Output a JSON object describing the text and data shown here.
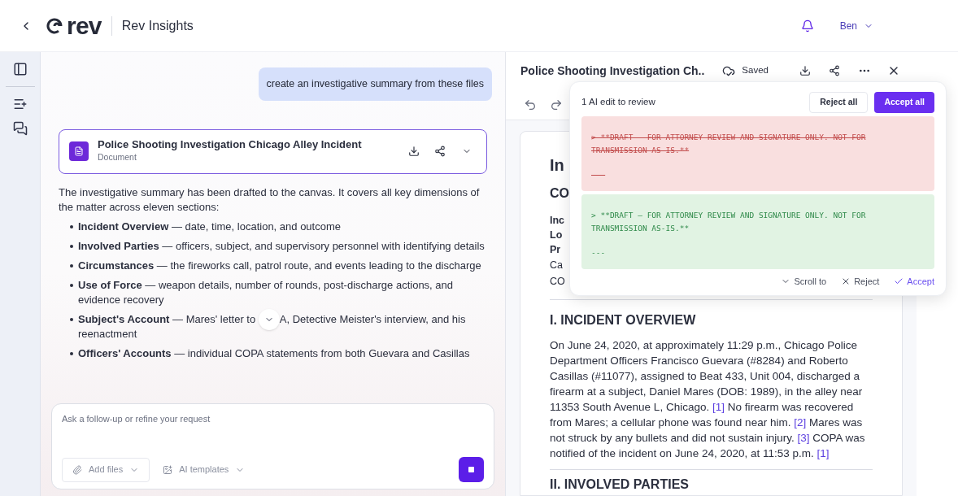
{
  "header": {
    "logo_text": "rev",
    "app_title": "Rev Insights",
    "user": "Ben"
  },
  "chat": {
    "user_message": "create an investigative summary from these files",
    "document_card": {
      "title": "Police Shooting Investigation Chicago Alley Incident",
      "subtitle": "Document"
    },
    "intro": "The investigative summary has been drafted to the canvas. It covers all key dimensions of the matter across eleven sections:",
    "bullets": [
      {
        "text": "**Incident Overview** — date, time, location, and outcome"
      },
      {
        "text": "**Involved Parties** — officers, subject, and supervisory personnel with identifying details"
      },
      {
        "text": "**Circumstances** — the fireworks call, patrol route, and events leading to the discharge"
      },
      {
        "text": "**Use of Force** — weapon details, number of rounds, post-discharge actions, and evidence recovery"
      },
      {
        "text": "**Subject's Account** — Mares' letter to",
        "after_button": "A, Detective Meister's interview, and his reenactment"
      },
      {
        "text": "**Officers' Accounts** — individual COPA statements from both Guevara and Casillas"
      }
    ],
    "input": {
      "placeholder": "Ask a follow-up or refine your request",
      "add_files": "Add files",
      "templates": "AI templates"
    }
  },
  "document": {
    "title": "Police Shooting Investigation Ch..",
    "save_status": "Saved",
    "hidden_fragments": [
      {
        "kind": "h1",
        "text": "In"
      },
      {
        "kind": "h2",
        "text": "CO"
      },
      {
        "kind": "bold",
        "text": "Inc"
      },
      {
        "kind": "bold",
        "text": "Lo"
      },
      {
        "kind": "bold",
        "text": "Pr"
      },
      {
        "kind": "plain",
        "text": "Ca"
      },
      {
        "kind": "plain",
        "text": "CO"
      }
    ],
    "section_1": {
      "heading": "I. INCIDENT OVERVIEW",
      "segments": [
        {
          "kind": "text",
          "text": "On June 24, 2020, at approximately 11:29 p.m., Chicago Police Department Officers Francisco Guevara (#8284) and Roberto Casillas (#11077), assigned to Beat 433, Unit 004, discharged a firearm at a subject, Daniel Mares (DOB: 1989), in the alley near 11353 South Avenue L, Chicago. "
        },
        {
          "kind": "cite",
          "text": "[1]"
        },
        {
          "kind": "text",
          "text": " No firearm was recovered from Mares; a cellular phone was found near him. "
        },
        {
          "kind": "cite",
          "text": "[2]"
        },
        {
          "kind": "text",
          "text": " Mares was not struck by any bullets and did not sustain injury. "
        },
        {
          "kind": "cite",
          "text": "[3]"
        },
        {
          "kind": "text",
          "text": " COPA was notified of the incident on June 24, 2020, at 11:53 p.m. "
        },
        {
          "kind": "cite",
          "text": "[1]"
        }
      ]
    },
    "section_2": {
      "heading": "II. INVOLVED PARTIES"
    }
  },
  "review": {
    "summary": "1 AI edit to review",
    "reject_all": "Reject all",
    "accept_all": "Accept all",
    "diffs": [
      {
        "kind": "removed",
        "body": "> **DRAFT — FOR ATTORNEY REVIEW AND SIGNATURE ONLY. NOT FOR TRANSMISSION AS-IS.**",
        "rule": "---"
      },
      {
        "kind": "added",
        "body": "> **DRAFT — FOR ATTORNEY REVIEW AND SIGNATURE ONLY. NOT FOR TRANSMISSION AS-IS.**",
        "rule": "---"
      }
    ],
    "scroll_to": "Scroll to",
    "reject": "Reject",
    "accept": "Accept"
  }
}
